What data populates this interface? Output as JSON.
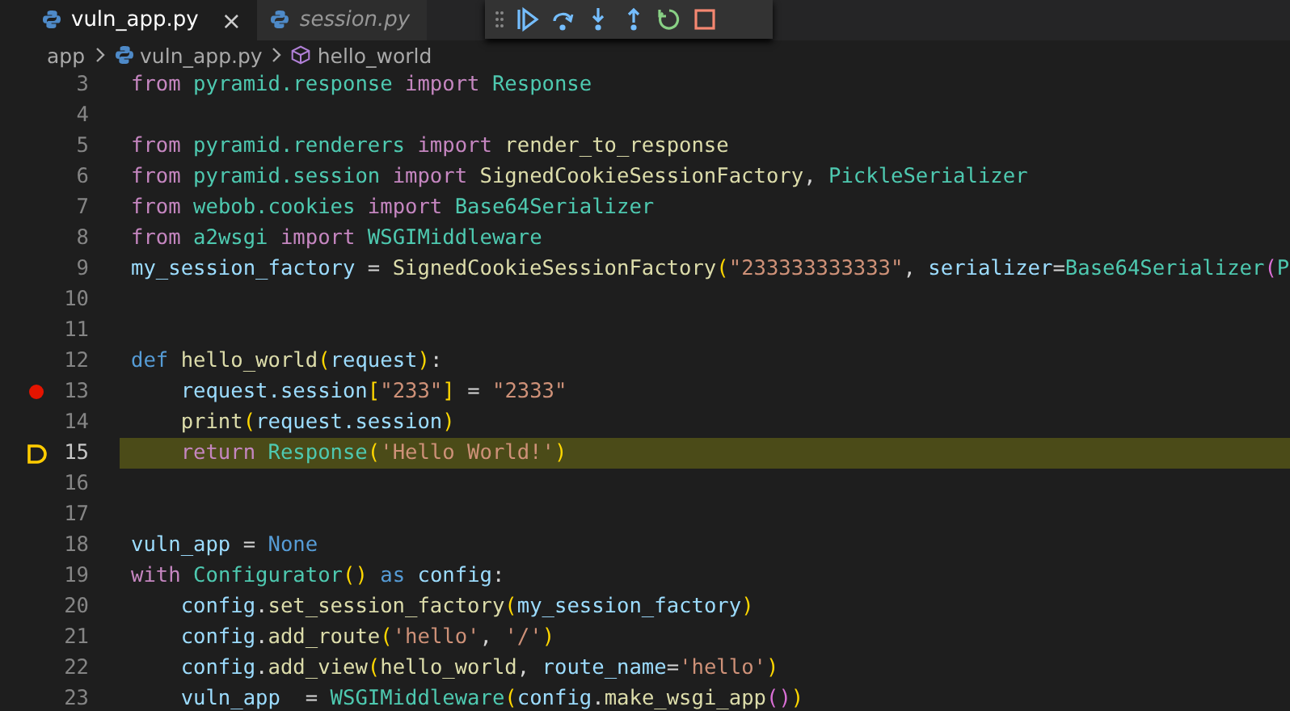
{
  "tabs": [
    {
      "label": "vuln_app.py",
      "selected": true,
      "preview": false,
      "close": "×"
    },
    {
      "label": "session.py",
      "selected": false,
      "preview": true
    }
  ],
  "debug_toolbar": [
    {
      "kind": "continue"
    },
    {
      "kind": "step-over"
    },
    {
      "kind": "step-into"
    },
    {
      "kind": "step-out"
    },
    {
      "kind": "restart"
    },
    {
      "kind": "stop"
    }
  ],
  "breadcrumb": [
    {
      "kind": "folder",
      "label": "app"
    },
    {
      "kind": "file",
      "label": "vuln_app.py"
    },
    {
      "kind": "symbol",
      "label": "hello_world"
    }
  ],
  "lines": [
    {
      "number": "3",
      "breakpoint": false,
      "current": false,
      "tokens": [
        {
          "kind": "keyword",
          "text": "from"
        },
        {
          "kind": "module",
          "text": " pyramid.response"
        },
        {
          "kind": "keyword",
          "text": " import"
        },
        {
          "kind": "module",
          "text": " Response"
        }
      ]
    },
    {
      "number": "4",
      "breakpoint": false,
      "current": false
    },
    {
      "number": "5",
      "breakpoint": false,
      "current": false,
      "tokens": [
        {
          "kind": "keyword",
          "text": "from"
        },
        {
          "kind": "module",
          "text": " pyramid.renderers"
        },
        {
          "kind": "keyword",
          "text": " import"
        },
        {
          "kind": "func",
          "text": " render_to_response"
        }
      ]
    },
    {
      "number": "6",
      "breakpoint": false,
      "current": false,
      "tokens": [
        {
          "kind": "keyword",
          "text": "from"
        },
        {
          "kind": "module",
          "text": " pyramid.session"
        },
        {
          "kind": "keyword",
          "text": " import"
        },
        {
          "kind": "func",
          "text": " SignedCookieSessionFactory"
        },
        {
          "kind": "plain",
          "text": ","
        },
        {
          "kind": "module",
          "text": " PickleSerializer"
        }
      ]
    },
    {
      "number": "7",
      "breakpoint": false,
      "current": false,
      "tokens": [
        {
          "kind": "keyword",
          "text": "from"
        },
        {
          "kind": "module",
          "text": " webob.cookies"
        },
        {
          "kind": "keyword",
          "text": " import"
        },
        {
          "kind": "module",
          "text": " Base64Serializer"
        }
      ]
    },
    {
      "number": "8",
      "breakpoint": false,
      "current": false,
      "tokens": [
        {
          "kind": "keyword",
          "text": "from"
        },
        {
          "kind": "module",
          "text": " a2wsgi"
        },
        {
          "kind": "keyword",
          "text": " import"
        },
        {
          "kind": "module",
          "text": " WSGIMiddleware"
        }
      ]
    },
    {
      "number": "9",
      "breakpoint": false,
      "current": false,
      "tokens": [
        {
          "kind": "var",
          "text": "my_session_factory"
        },
        {
          "kind": "plain",
          "text": " ="
        },
        {
          "kind": "func",
          "text": " SignedCookieSessionFactory"
        },
        {
          "kind": "bracket",
          "text": "("
        },
        {
          "kind": "string",
          "text": "\"233333333333\""
        },
        {
          "kind": "plain",
          "text": ","
        },
        {
          "kind": "var",
          "text": " serializer"
        },
        {
          "kind": "plain",
          "text": "="
        },
        {
          "kind": "module",
          "text": "Base64Serializer"
        },
        {
          "kind": "bracket2",
          "text": "("
        },
        {
          "kind": "module",
          "text": "P"
        }
      ]
    },
    {
      "number": "10",
      "breakpoint": false,
      "current": false
    },
    {
      "number": "11",
      "breakpoint": false,
      "current": false
    },
    {
      "number": "12",
      "breakpoint": false,
      "current": false,
      "tokens": [
        {
          "kind": "storage",
          "text": "def"
        },
        {
          "kind": "func",
          "text": " hello_world"
        },
        {
          "kind": "bracket",
          "text": "("
        },
        {
          "kind": "var",
          "text": "request"
        },
        {
          "kind": "bracket",
          "text": ")"
        },
        {
          "kind": "plain",
          "text": ":"
        }
      ]
    },
    {
      "number": "13",
      "breakpoint": true,
      "current": false,
      "tokens": [
        {
          "kind": "var",
          "text": "    request.session"
        },
        {
          "kind": "bracket",
          "text": "["
        },
        {
          "kind": "string",
          "text": "\"233\""
        },
        {
          "kind": "bracket",
          "text": "]"
        },
        {
          "kind": "plain",
          "text": " ="
        },
        {
          "kind": "string",
          "text": " \"2333\""
        }
      ]
    },
    {
      "number": "14",
      "breakpoint": false,
      "current": false,
      "tokens": [
        {
          "kind": "func",
          "text": "    print"
        },
        {
          "kind": "bracket",
          "text": "("
        },
        {
          "kind": "var",
          "text": "request.session"
        },
        {
          "kind": "bracket",
          "text": ")"
        }
      ]
    },
    {
      "number": "15",
      "breakpoint": false,
      "current": true,
      "tokens": [
        {
          "kind": "keyword",
          "text": "    return"
        },
        {
          "kind": "module",
          "text": " Response"
        },
        {
          "kind": "bracket",
          "text": "("
        },
        {
          "kind": "string",
          "text": "'Hello World!'"
        },
        {
          "kind": "bracket",
          "text": ")"
        }
      ]
    },
    {
      "number": "16",
      "breakpoint": false,
      "current": false
    },
    {
      "number": "17",
      "breakpoint": false,
      "current": false
    },
    {
      "number": "18",
      "breakpoint": false,
      "current": false,
      "tokens": [
        {
          "kind": "var",
          "text": "vuln_app"
        },
        {
          "kind": "plain",
          "text": " ="
        },
        {
          "kind": "storage",
          "text": " None"
        }
      ]
    },
    {
      "number": "19",
      "breakpoint": false,
      "current": false,
      "tokens": [
        {
          "kind": "keyword",
          "text": "with"
        },
        {
          "kind": "module",
          "text": " Configurator"
        },
        {
          "kind": "bracket",
          "text": "()"
        },
        {
          "kind": "storage",
          "text": " as"
        },
        {
          "kind": "var",
          "text": " config"
        },
        {
          "kind": "plain",
          "text": ":"
        }
      ]
    },
    {
      "number": "20",
      "breakpoint": false,
      "current": false,
      "tokens": [
        {
          "kind": "var",
          "text": "    config"
        },
        {
          "kind": "plain",
          "text": "."
        },
        {
          "kind": "func",
          "text": "set_session_factory"
        },
        {
          "kind": "bracket",
          "text": "("
        },
        {
          "kind": "var",
          "text": "my_session_factory"
        },
        {
          "kind": "bracket",
          "text": ")"
        }
      ]
    },
    {
      "number": "21",
      "breakpoint": false,
      "current": false,
      "tokens": [
        {
          "kind": "var",
          "text": "    config"
        },
        {
          "kind": "plain",
          "text": "."
        },
        {
          "kind": "func",
          "text": "add_route"
        },
        {
          "kind": "bracket",
          "text": "("
        },
        {
          "kind": "string",
          "text": "'hello'"
        },
        {
          "kind": "plain",
          "text": ","
        },
        {
          "kind": "string",
          "text": " '/'"
        },
        {
          "kind": "bracket",
          "text": ")"
        }
      ]
    },
    {
      "number": "22",
      "breakpoint": false,
      "current": false,
      "tokens": [
        {
          "kind": "var",
          "text": "    config"
        },
        {
          "kind": "plain",
          "text": "."
        },
        {
          "kind": "func",
          "text": "add_view"
        },
        {
          "kind": "bracket",
          "text": "("
        },
        {
          "kind": "func",
          "text": "hello_world"
        },
        {
          "kind": "plain",
          "text": ","
        },
        {
          "kind": "var",
          "text": " route_name"
        },
        {
          "kind": "plain",
          "text": "="
        },
        {
          "kind": "string",
          "text": "'hello'"
        },
        {
          "kind": "bracket",
          "text": ")"
        }
      ]
    },
    {
      "number": "23",
      "breakpoint": false,
      "current": false,
      "tokens": [
        {
          "kind": "var",
          "text": "    vuln_app"
        },
        {
          "kind": "plain",
          "text": "  ="
        },
        {
          "kind": "module",
          "text": " WSGIMiddleware"
        },
        {
          "kind": "bracket",
          "text": "("
        },
        {
          "kind": "var",
          "text": "config"
        },
        {
          "kind": "plain",
          "text": "."
        },
        {
          "kind": "func",
          "text": "make_wsgi_app"
        },
        {
          "kind": "bracket2",
          "text": "()"
        },
        {
          "kind": "bracket",
          "text": ")"
        }
      ]
    }
  ]
}
